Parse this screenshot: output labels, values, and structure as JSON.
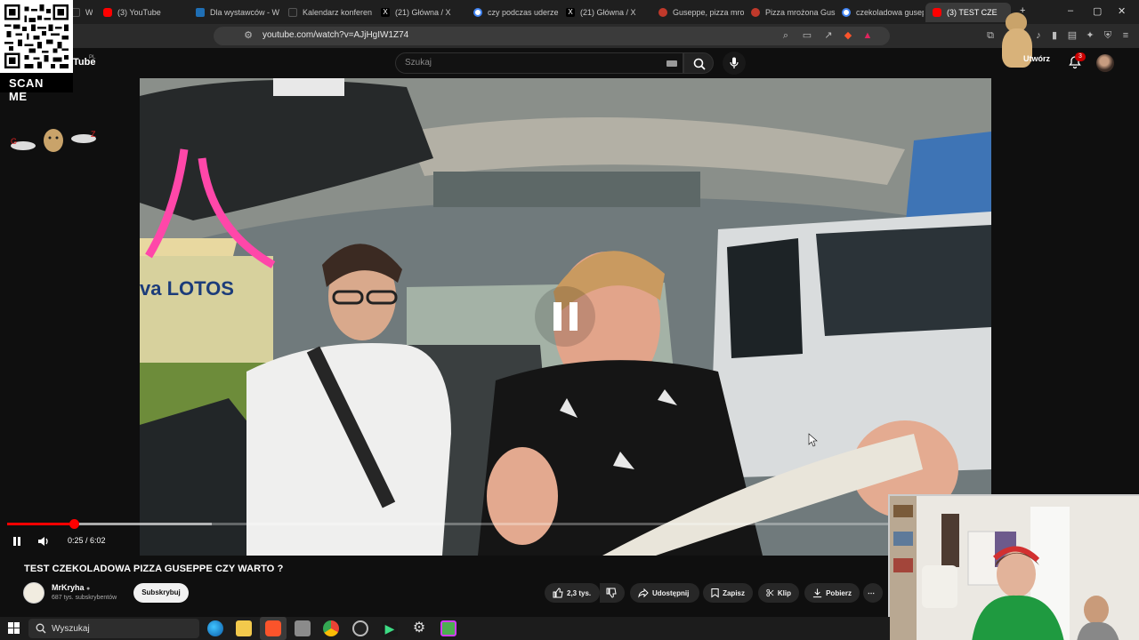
{
  "browser": {
    "tabs": [
      {
        "label": "WO",
        "icon": "kick-icon"
      },
      {
        "label": "(3) YouTube",
        "icon": "youtube-icon"
      },
      {
        "label": "Dla wystawców - W",
        "icon": "site-icon"
      },
      {
        "label": "Kalendarz konferen",
        "icon": "calendar-site-icon"
      },
      {
        "label": "(21) Główna / X",
        "icon": "x-icon"
      },
      {
        "label": "czy podczas uderze",
        "icon": "google-icon"
      },
      {
        "label": "(21) Główna / X",
        "icon": "x-icon"
      },
      {
        "label": "Guseppe, pizza mro",
        "icon": "pizza-icon"
      },
      {
        "label": "Pizza mrożona Gus",
        "icon": "pizza-icon"
      },
      {
        "label": "czekoladowa gusep",
        "icon": "google-icon"
      },
      {
        "label": "(3) TEST CZE",
        "icon": "youtube-icon",
        "active": true
      }
    ],
    "url": "youtube.com/watch?v=AJjHgIW1Z74"
  },
  "youtube": {
    "logo_text": "Tube",
    "logo_region": "PL",
    "search_placeholder": "Szukaj",
    "create_label": "Utwórz",
    "notification_count": "3"
  },
  "overlay": {
    "scan_label": "SCAN ME"
  },
  "player": {
    "time": "0:25 / 6:02",
    "progress": 0.069,
    "buffered": 0.21,
    "center_icon": "pause-icon"
  },
  "video": {
    "title": "TEST CZEKOLADOWA PIZZA GUSEPPE CZY WARTO ?",
    "channel": "MrKryha",
    "subscribers": "687 tys. subskrybentów",
    "subscribe_label": "Subskrybuj",
    "likes": "2,3 tys.",
    "share_label": "Udostępnij",
    "save_label": "Zapisz",
    "clip_label": "Klip",
    "download_label": "Pobierz",
    "scene_sign": "va LOTOS"
  },
  "taskbar": {
    "search_placeholder": "Wyszukaj"
  },
  "colors": {
    "accent": "#ff0000",
    "background": "#0f0f0f"
  }
}
